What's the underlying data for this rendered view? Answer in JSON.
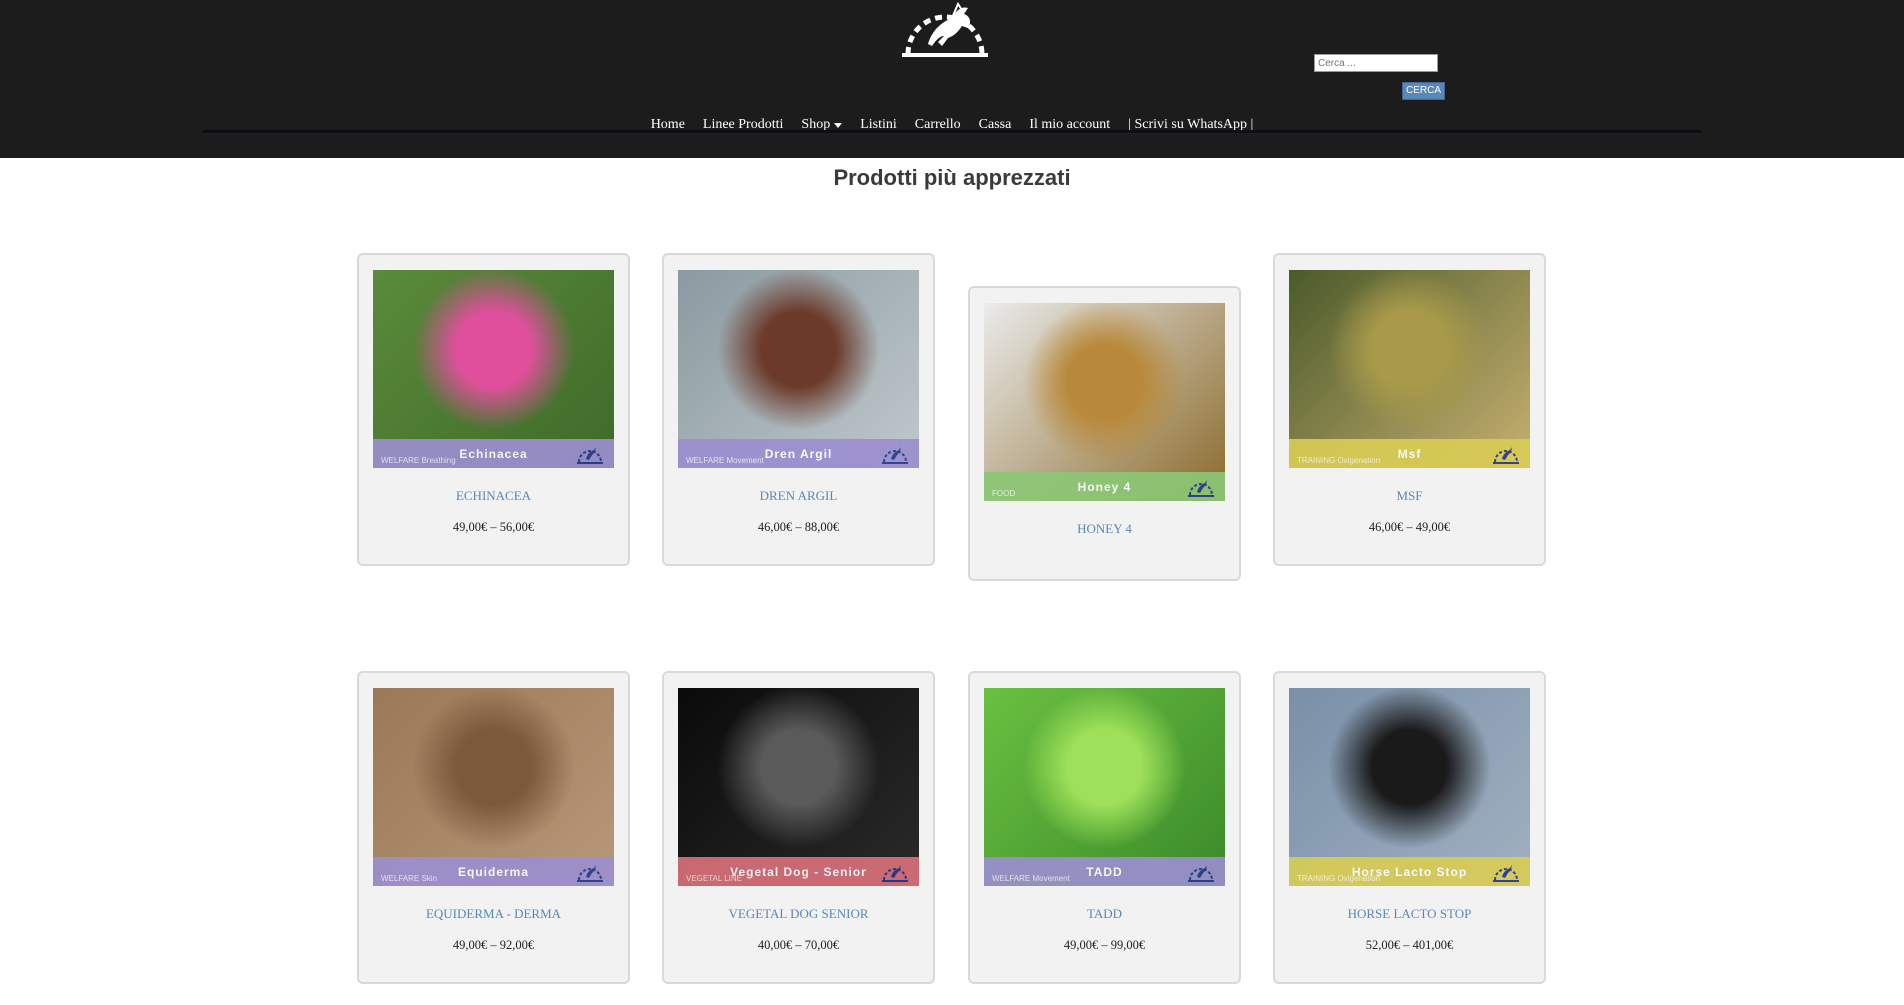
{
  "search": {
    "placeholder": "Cerca ...",
    "button_label": "CERCA"
  },
  "nav": {
    "items": [
      {
        "label": "Home"
      },
      {
        "label": "Linee Prodotti"
      },
      {
        "label": "Shop"
      },
      {
        "label": "Listini"
      },
      {
        "label": "Carrello"
      },
      {
        "label": "Cassa"
      },
      {
        "label": "Il mio account"
      },
      {
        "label": "| Scrivi su WhatsApp |"
      }
    ]
  },
  "section": {
    "title": "Prodotti più apprezzati"
  },
  "products": [
    {
      "name": "ECHINACEA",
      "price": "49,00€ – 56,00€",
      "band_label": "Echinacea",
      "band_category": "WELFARE Breathing",
      "band_color": "#9b8fcf",
      "image_colors": [
        "#5a8a3a",
        "#e04f9c",
        "#3e6b2a"
      ]
    },
    {
      "name": "DREN ARGIL",
      "price": "46,00€ – 88,00€",
      "band_label": "Dren Argil",
      "band_category": "WELFARE Movement",
      "band_color": "#9b8fcf",
      "image_colors": [
        "#8a9aa0",
        "#6b3a2a",
        "#c0c8cc"
      ]
    },
    {
      "name": "HONEY 4",
      "price": "",
      "band_label": "Honey 4",
      "band_category": "FOOD",
      "band_color": "#8cc776",
      "image_colors": [
        "#ebebeb",
        "#b8893a",
        "#8a6a2a"
      ]
    },
    {
      "name": "MSF",
      "price": "46,00€ – 49,00€",
      "band_label": "Msf",
      "band_category": "TRAINING Oxigenation",
      "band_color": "#d8cc55",
      "image_colors": [
        "#4a5a2a",
        "#a89a4a",
        "#c8b070"
      ]
    },
    {
      "name": "EQUIDERMA - DERMA",
      "price": "49,00€ – 92,00€",
      "band_label": "Equiderma",
      "band_category": "WELFARE Skin",
      "band_color": "#9b8fcf",
      "image_colors": [
        "#9a7858",
        "#7a5a3a",
        "#b89878"
      ]
    },
    {
      "name": "VEGETAL DOG SENIOR",
      "price": "40,00€ – 70,00€",
      "band_label": "Vegetal Dog - Senior",
      "band_category": "VEGETAL LINE",
      "band_color": "#d8707a",
      "image_colors": [
        "#0a0a0a",
        "#5a5a5a",
        "#2a2a2a"
      ]
    },
    {
      "name": "TADD",
      "price": "49,00€ – 99,00€",
      "band_label": "TADD",
      "band_category": "WELFARE Movement",
      "band_color": "#9b8fcf",
      "image_colors": [
        "#6ac040",
        "#9ee05a",
        "#3a8a2a"
      ]
    },
    {
      "name": "HORSE LACTO STOP",
      "price": "52,00€ – 401,00€",
      "band_label": "Horse Lacto Stop",
      "band_category": "TRAINING Oxigenation",
      "band_color": "#d8cc55",
      "image_colors": [
        "#7a90a8",
        "#1a1a1a",
        "#a0b0c0"
      ]
    }
  ]
}
